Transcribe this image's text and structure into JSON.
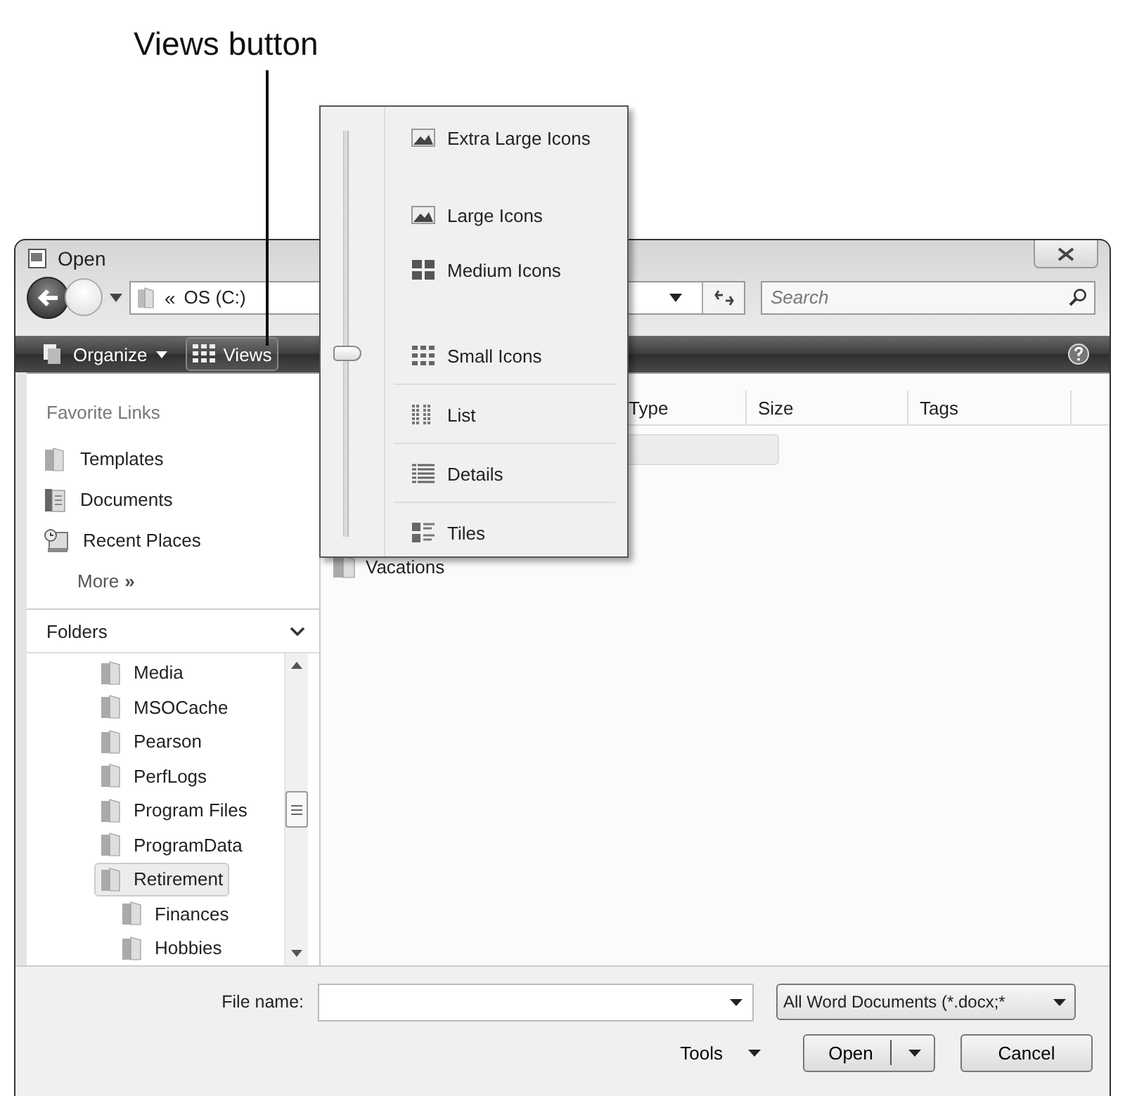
{
  "callout": {
    "label": "Views button"
  },
  "window": {
    "title": "Open"
  },
  "address": {
    "chevron": "«",
    "path": "OS (C:)"
  },
  "search": {
    "placeholder": "Search"
  },
  "toolbar": {
    "organize": "Organize",
    "views": "Views"
  },
  "favorite_links": {
    "heading": "Favorite Links",
    "items": [
      {
        "label": "Templates",
        "kind": "folder"
      },
      {
        "label": "Documents",
        "kind": "documents"
      },
      {
        "label": "Recent Places",
        "kind": "recent"
      }
    ],
    "more": "More",
    "more_glyph": "»"
  },
  "folders": {
    "heading": "Folders",
    "tree": [
      {
        "label": "Media",
        "selected": false
      },
      {
        "label": "MSOCache",
        "selected": false
      },
      {
        "label": "Pearson",
        "selected": false
      },
      {
        "label": "PerfLogs",
        "selected": false
      },
      {
        "label": "Program Files",
        "selected": false
      },
      {
        "label": "ProgramData",
        "selected": false
      },
      {
        "label": "Retirement",
        "selected": true,
        "children": [
          {
            "label": "Finances",
            "selected": false
          },
          {
            "label": "Hobbies",
            "selected": false
          }
        ]
      }
    ]
  },
  "file_list": {
    "columns": [
      "Type",
      "Size",
      "Tags"
    ],
    "items": [
      {
        "label": "Vacations"
      }
    ]
  },
  "file_name": {
    "label": "File name:"
  },
  "file_type": {
    "value": "All Word Documents (*.docx;*"
  },
  "buttons": {
    "tools": "Tools",
    "open": "Open",
    "cancel": "Cancel"
  },
  "views_menu": {
    "level": 0.45,
    "items": [
      {
        "label": "Extra Large Icons"
      },
      {
        "label": "Large Icons"
      },
      {
        "label": "Medium Icons"
      },
      {
        "label": "Small Icons"
      },
      {
        "label": "List"
      },
      {
        "label": "Details"
      },
      {
        "label": "Tiles"
      }
    ]
  }
}
